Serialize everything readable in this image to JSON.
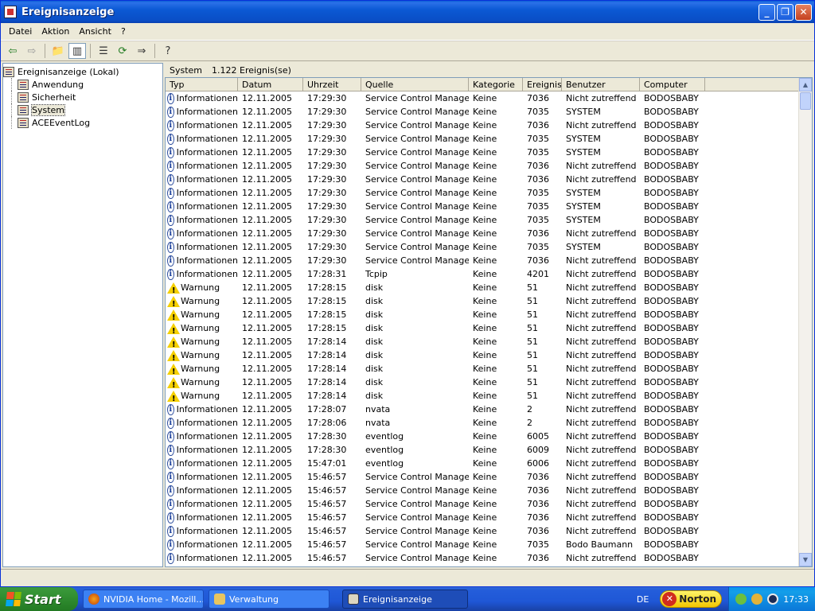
{
  "window": {
    "title": "Ereignisanzeige"
  },
  "menu": [
    "Datei",
    "Aktion",
    "Ansicht",
    "?"
  ],
  "tree": {
    "root": "Ereignisanzeige (Lokal)",
    "children": [
      "Anwendung",
      "Sicherheit",
      "System",
      "ACEEventLog"
    ],
    "selected": "System"
  },
  "header": {
    "log": "System",
    "count": "1.122 Ereignis(se)"
  },
  "columns": [
    "Typ",
    "Datum",
    "Uhrzeit",
    "Quelle",
    "Kategorie",
    "Ereignis",
    "Benutzer",
    "Computer"
  ],
  "rows": [
    [
      "info",
      "Informationen",
      "12.11.2005",
      "17:29:30",
      "Service Control Manager",
      "Keine",
      "7036",
      "Nicht zutreffend",
      "BODOSBABY"
    ],
    [
      "info",
      "Informationen",
      "12.11.2005",
      "17:29:30",
      "Service Control Manager",
      "Keine",
      "7035",
      "SYSTEM",
      "BODOSBABY"
    ],
    [
      "info",
      "Informationen",
      "12.11.2005",
      "17:29:30",
      "Service Control Manager",
      "Keine",
      "7036",
      "Nicht zutreffend",
      "BODOSBABY"
    ],
    [
      "info",
      "Informationen",
      "12.11.2005",
      "17:29:30",
      "Service Control Manager",
      "Keine",
      "7035",
      "SYSTEM",
      "BODOSBABY"
    ],
    [
      "info",
      "Informationen",
      "12.11.2005",
      "17:29:30",
      "Service Control Manager",
      "Keine",
      "7035",
      "SYSTEM",
      "BODOSBABY"
    ],
    [
      "info",
      "Informationen",
      "12.11.2005",
      "17:29:30",
      "Service Control Manager",
      "Keine",
      "7036",
      "Nicht zutreffend",
      "BODOSBABY"
    ],
    [
      "info",
      "Informationen",
      "12.11.2005",
      "17:29:30",
      "Service Control Manager",
      "Keine",
      "7036",
      "Nicht zutreffend",
      "BODOSBABY"
    ],
    [
      "info",
      "Informationen",
      "12.11.2005",
      "17:29:30",
      "Service Control Manager",
      "Keine",
      "7035",
      "SYSTEM",
      "BODOSBABY"
    ],
    [
      "info",
      "Informationen",
      "12.11.2005",
      "17:29:30",
      "Service Control Manager",
      "Keine",
      "7035",
      "SYSTEM",
      "BODOSBABY"
    ],
    [
      "info",
      "Informationen",
      "12.11.2005",
      "17:29:30",
      "Service Control Manager",
      "Keine",
      "7035",
      "SYSTEM",
      "BODOSBABY"
    ],
    [
      "info",
      "Informationen",
      "12.11.2005",
      "17:29:30",
      "Service Control Manager",
      "Keine",
      "7036",
      "Nicht zutreffend",
      "BODOSBABY"
    ],
    [
      "info",
      "Informationen",
      "12.11.2005",
      "17:29:30",
      "Service Control Manager",
      "Keine",
      "7035",
      "SYSTEM",
      "BODOSBABY"
    ],
    [
      "info",
      "Informationen",
      "12.11.2005",
      "17:29:30",
      "Service Control Manager",
      "Keine",
      "7036",
      "Nicht zutreffend",
      "BODOSBABY"
    ],
    [
      "info",
      "Informationen",
      "12.11.2005",
      "17:28:31",
      "Tcpip",
      "Keine",
      "4201",
      "Nicht zutreffend",
      "BODOSBABY"
    ],
    [
      "warn",
      "Warnung",
      "12.11.2005",
      "17:28:15",
      "disk",
      "Keine",
      "51",
      "Nicht zutreffend",
      "BODOSBABY"
    ],
    [
      "warn",
      "Warnung",
      "12.11.2005",
      "17:28:15",
      "disk",
      "Keine",
      "51",
      "Nicht zutreffend",
      "BODOSBABY"
    ],
    [
      "warn",
      "Warnung",
      "12.11.2005",
      "17:28:15",
      "disk",
      "Keine",
      "51",
      "Nicht zutreffend",
      "BODOSBABY"
    ],
    [
      "warn",
      "Warnung",
      "12.11.2005",
      "17:28:15",
      "disk",
      "Keine",
      "51",
      "Nicht zutreffend",
      "BODOSBABY"
    ],
    [
      "warn",
      "Warnung",
      "12.11.2005",
      "17:28:14",
      "disk",
      "Keine",
      "51",
      "Nicht zutreffend",
      "BODOSBABY"
    ],
    [
      "warn",
      "Warnung",
      "12.11.2005",
      "17:28:14",
      "disk",
      "Keine",
      "51",
      "Nicht zutreffend",
      "BODOSBABY"
    ],
    [
      "warn",
      "Warnung",
      "12.11.2005",
      "17:28:14",
      "disk",
      "Keine",
      "51",
      "Nicht zutreffend",
      "BODOSBABY"
    ],
    [
      "warn",
      "Warnung",
      "12.11.2005",
      "17:28:14",
      "disk",
      "Keine",
      "51",
      "Nicht zutreffend",
      "BODOSBABY"
    ],
    [
      "warn",
      "Warnung",
      "12.11.2005",
      "17:28:14",
      "disk",
      "Keine",
      "51",
      "Nicht zutreffend",
      "BODOSBABY"
    ],
    [
      "info",
      "Informationen",
      "12.11.2005",
      "17:28:07",
      "nvata",
      "Keine",
      "2",
      "Nicht zutreffend",
      "BODOSBABY"
    ],
    [
      "info",
      "Informationen",
      "12.11.2005",
      "17:28:06",
      "nvata",
      "Keine",
      "2",
      "Nicht zutreffend",
      "BODOSBABY"
    ],
    [
      "info",
      "Informationen",
      "12.11.2005",
      "17:28:30",
      "eventlog",
      "Keine",
      "6005",
      "Nicht zutreffend",
      "BODOSBABY"
    ],
    [
      "info",
      "Informationen",
      "12.11.2005",
      "17:28:30",
      "eventlog",
      "Keine",
      "6009",
      "Nicht zutreffend",
      "BODOSBABY"
    ],
    [
      "info",
      "Informationen",
      "12.11.2005",
      "15:47:01",
      "eventlog",
      "Keine",
      "6006",
      "Nicht zutreffend",
      "BODOSBABY"
    ],
    [
      "info",
      "Informationen",
      "12.11.2005",
      "15:46:57",
      "Service Control Manager",
      "Keine",
      "7036",
      "Nicht zutreffend",
      "BODOSBABY"
    ],
    [
      "info",
      "Informationen",
      "12.11.2005",
      "15:46:57",
      "Service Control Manager",
      "Keine",
      "7036",
      "Nicht zutreffend",
      "BODOSBABY"
    ],
    [
      "info",
      "Informationen",
      "12.11.2005",
      "15:46:57",
      "Service Control Manager",
      "Keine",
      "7036",
      "Nicht zutreffend",
      "BODOSBABY"
    ],
    [
      "info",
      "Informationen",
      "12.11.2005",
      "15:46:57",
      "Service Control Manager",
      "Keine",
      "7036",
      "Nicht zutreffend",
      "BODOSBABY"
    ],
    [
      "info",
      "Informationen",
      "12.11.2005",
      "15:46:57",
      "Service Control Manager",
      "Keine",
      "7036",
      "Nicht zutreffend",
      "BODOSBABY"
    ],
    [
      "info",
      "Informationen",
      "12.11.2005",
      "15:46:57",
      "Service Control Manager",
      "Keine",
      "7035",
      "Bodo Baumann",
      "BODOSBABY"
    ],
    [
      "info",
      "Informationen",
      "12.11.2005",
      "15:46:57",
      "Service Control Manager",
      "Keine",
      "7036",
      "Nicht zutreffend",
      "BODOSBABY"
    ]
  ],
  "taskbar": {
    "start": "Start",
    "tasks": [
      {
        "label": "NVIDIA Home - Mozill...",
        "icon": "firefox-icon",
        "active": false
      },
      {
        "label": "Verwaltung",
        "icon": "folder-tools-icon",
        "active": false
      },
      {
        "label": "Ereignisanzeige",
        "icon": "event-viewer-icon",
        "active": true
      }
    ],
    "lang": "DE",
    "norton": "Norton",
    "clock": "17:33"
  }
}
